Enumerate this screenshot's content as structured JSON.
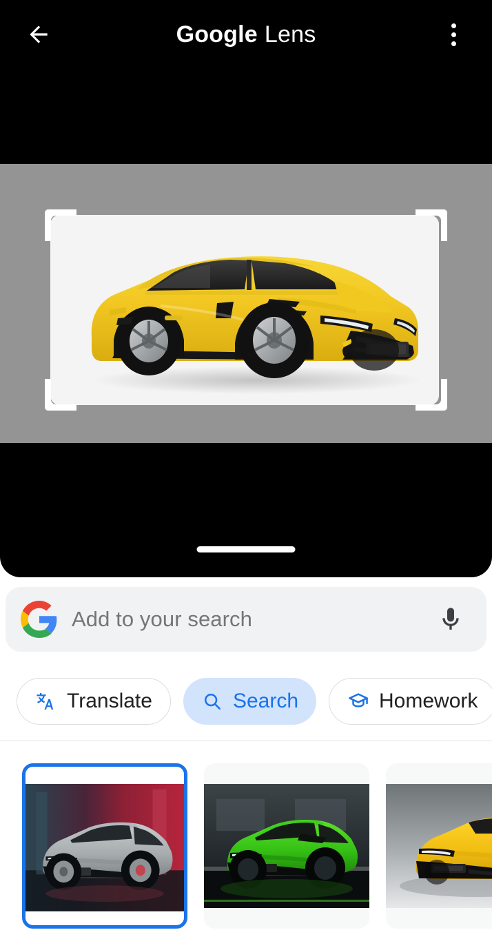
{
  "app": {
    "title_bold": "Google",
    "title_regular": "Lens",
    "background_color": "#000000",
    "accent_color": "#1a73e8"
  },
  "header": {
    "back_icon": "back-arrow-icon",
    "menu_icon": "overflow-menu-icon"
  },
  "viewer": {
    "scrim_color": "#949494",
    "subject": "yellow Lamborghini Urus SUV",
    "crop_brackets": "crop-selection-brackets",
    "drag_handle": "bottom-sheet-drag-handle"
  },
  "search": {
    "logo": "google-g-logo",
    "placeholder": "Add to your search",
    "value": "",
    "mic_icon": "microphone-icon",
    "background_color": "#f1f2f4"
  },
  "chips": [
    {
      "label": "Translate",
      "icon": "translate-icon",
      "selected": false
    },
    {
      "label": "Search",
      "icon": "search-icon",
      "selected": true
    },
    {
      "label": "Homework",
      "icon": "graduation-cap-icon",
      "selected": false
    }
  ],
  "results": [
    {
      "subject": "gray Lamborghini Urus, red and blue studio lighting",
      "selected": true
    },
    {
      "subject": "green Lamborghini Urus in dark showroom",
      "selected": false
    },
    {
      "subject": "yellow Lamborghini Urus on gray gradient background",
      "selected": false
    }
  ]
}
